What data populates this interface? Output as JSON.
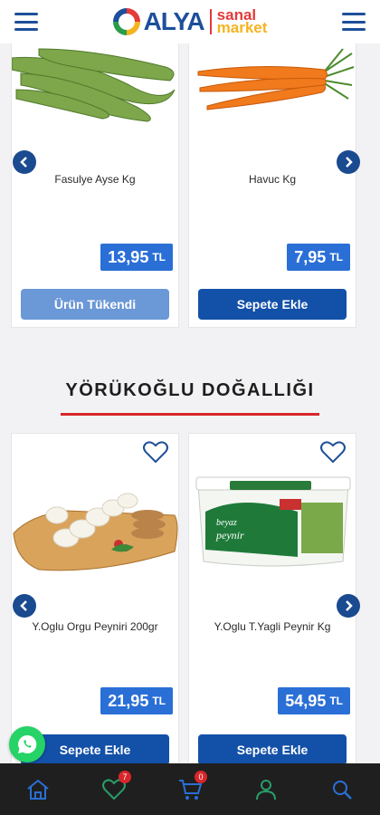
{
  "header": {
    "brand_main": "ALYA",
    "brand_sub_line1": "sanal",
    "brand_sub_line2": "market"
  },
  "top_products": [
    {
      "name": "Fasulye Ayse Kg",
      "price": "13,95",
      "currency": "TL",
      "button": "Ürün Tükendi",
      "available": false
    },
    {
      "name": "Havuc Kg",
      "price": "7,95",
      "currency": "TL",
      "button": "Sepete Ekle",
      "available": true
    }
  ],
  "section": {
    "title": "YÖRÜKOĞLU DOĞALLIĞI"
  },
  "section_products": [
    {
      "name": "Y.Oglu Orgu Peyniri 200gr",
      "price": "21,95",
      "currency": "TL",
      "button": "Sepete Ekle",
      "available": true
    },
    {
      "name": "Y.Oglu T.Yagli Peynir Kg",
      "price": "54,95",
      "currency": "TL",
      "button": "Sepete Ekle",
      "available": true
    }
  ],
  "bottom_nav": {
    "favorites_count": "7",
    "cart_count": "0"
  },
  "colors": {
    "brand_blue": "#1d4f9a",
    "price_blue": "#2a6fd6",
    "button_blue": "#1350a8",
    "button_disabled": "#6b98d6",
    "accent_red": "#d9262a"
  }
}
